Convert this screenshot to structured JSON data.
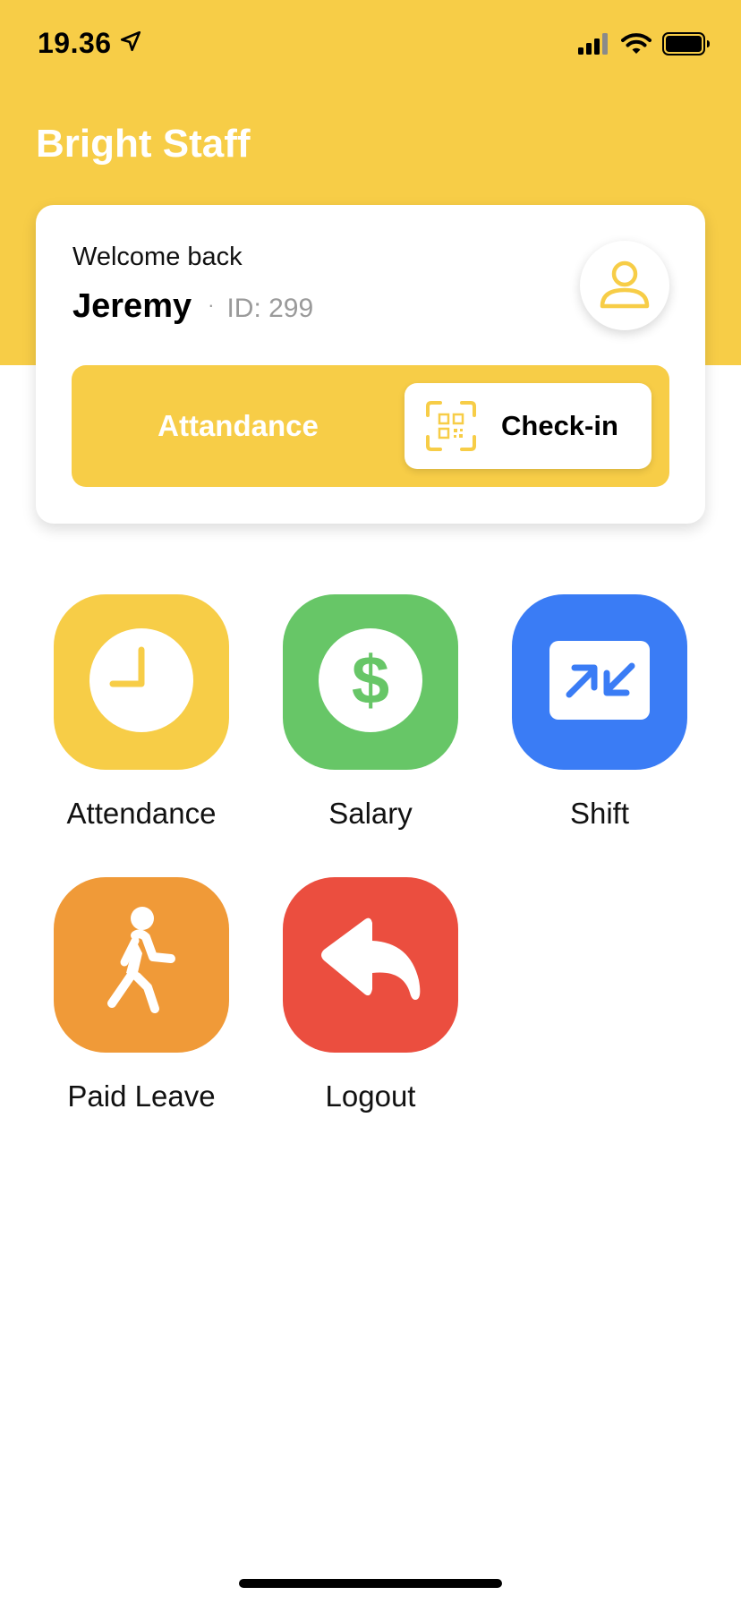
{
  "status_bar": {
    "time": "19.36",
    "icons": [
      "location-arrow-icon",
      "cellular-signal-icon",
      "wifi-icon",
      "battery-icon"
    ]
  },
  "app": {
    "title": "Bright Staff"
  },
  "welcome_card": {
    "greeting": "Welcome back",
    "user_name": "Jeremy",
    "separator": "·",
    "user_id": "ID: 299",
    "avatar_icon": "user-icon",
    "attendance_label": "Attandance",
    "checkin_label": "Check-in",
    "checkin_icon": "qr-scan-icon"
  },
  "menu": {
    "items": [
      {
        "label": "Attendance",
        "icon": "clock-icon",
        "color": "#F7CD47"
      },
      {
        "label": "Salary",
        "icon": "dollar-icon",
        "color": "#67C667"
      },
      {
        "label": "Shift",
        "icon": "swap-arrows-icon",
        "color": "#3A7CF5"
      },
      {
        "label": "Paid Leave",
        "icon": "walking-person-icon",
        "color": "#F09A38"
      },
      {
        "label": "Logout",
        "icon": "reply-arrow-icon",
        "color": "#EB4E3F"
      }
    ]
  },
  "colors": {
    "brand": "#F7CD47",
    "card_bg": "#FFFFFF",
    "muted_text": "#9A9A9A"
  }
}
